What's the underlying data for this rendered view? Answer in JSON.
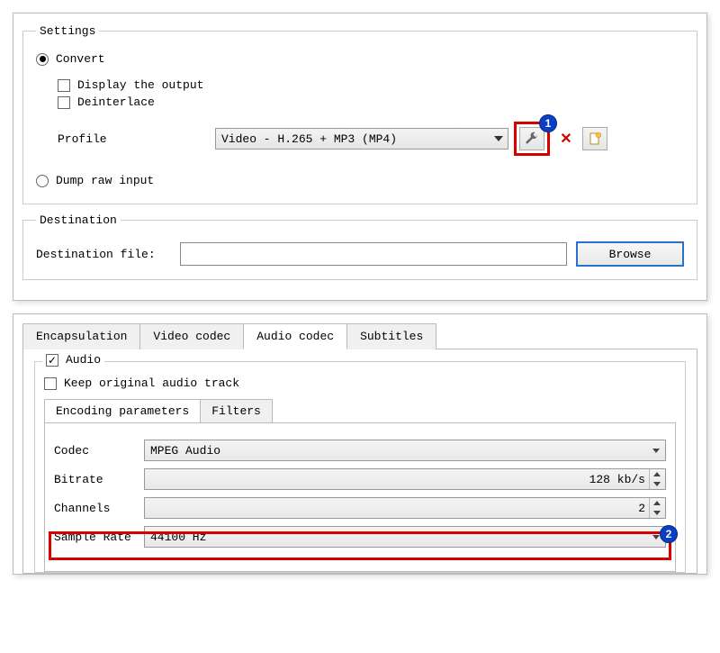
{
  "settings": {
    "legend": "Settings",
    "convert_label": "Convert",
    "display_output_label": "Display the output",
    "deinterlace_label": "Deinterlace",
    "profile_label": "Profile",
    "profile_value": "Video - H.265 + MP3 (MP4)",
    "dump_raw_label": "Dump raw input"
  },
  "destination": {
    "legend": "Destination",
    "file_label": "Destination file:",
    "file_value": "",
    "browse_label": "Browse"
  },
  "profile_editor": {
    "tabs": {
      "encapsulation": "Encapsulation",
      "video_codec": "Video codec",
      "audio_codec": "Audio codec",
      "subtitles": "Subtitles"
    },
    "audio_label": "Audio",
    "keep_original_label": "Keep original audio track",
    "subtabs": {
      "encoding": "Encoding parameters",
      "filters": "Filters"
    },
    "params": {
      "codec_label": "Codec",
      "codec_value": "MPEG Audio",
      "bitrate_label": "Bitrate",
      "bitrate_value": "128 kb/s",
      "channels_label": "Channels",
      "channels_value": "2",
      "samplerate_label": "Sample Rate",
      "samplerate_value": "44100 Hz"
    }
  },
  "annotations": {
    "badge1": "1",
    "badge2": "2"
  }
}
